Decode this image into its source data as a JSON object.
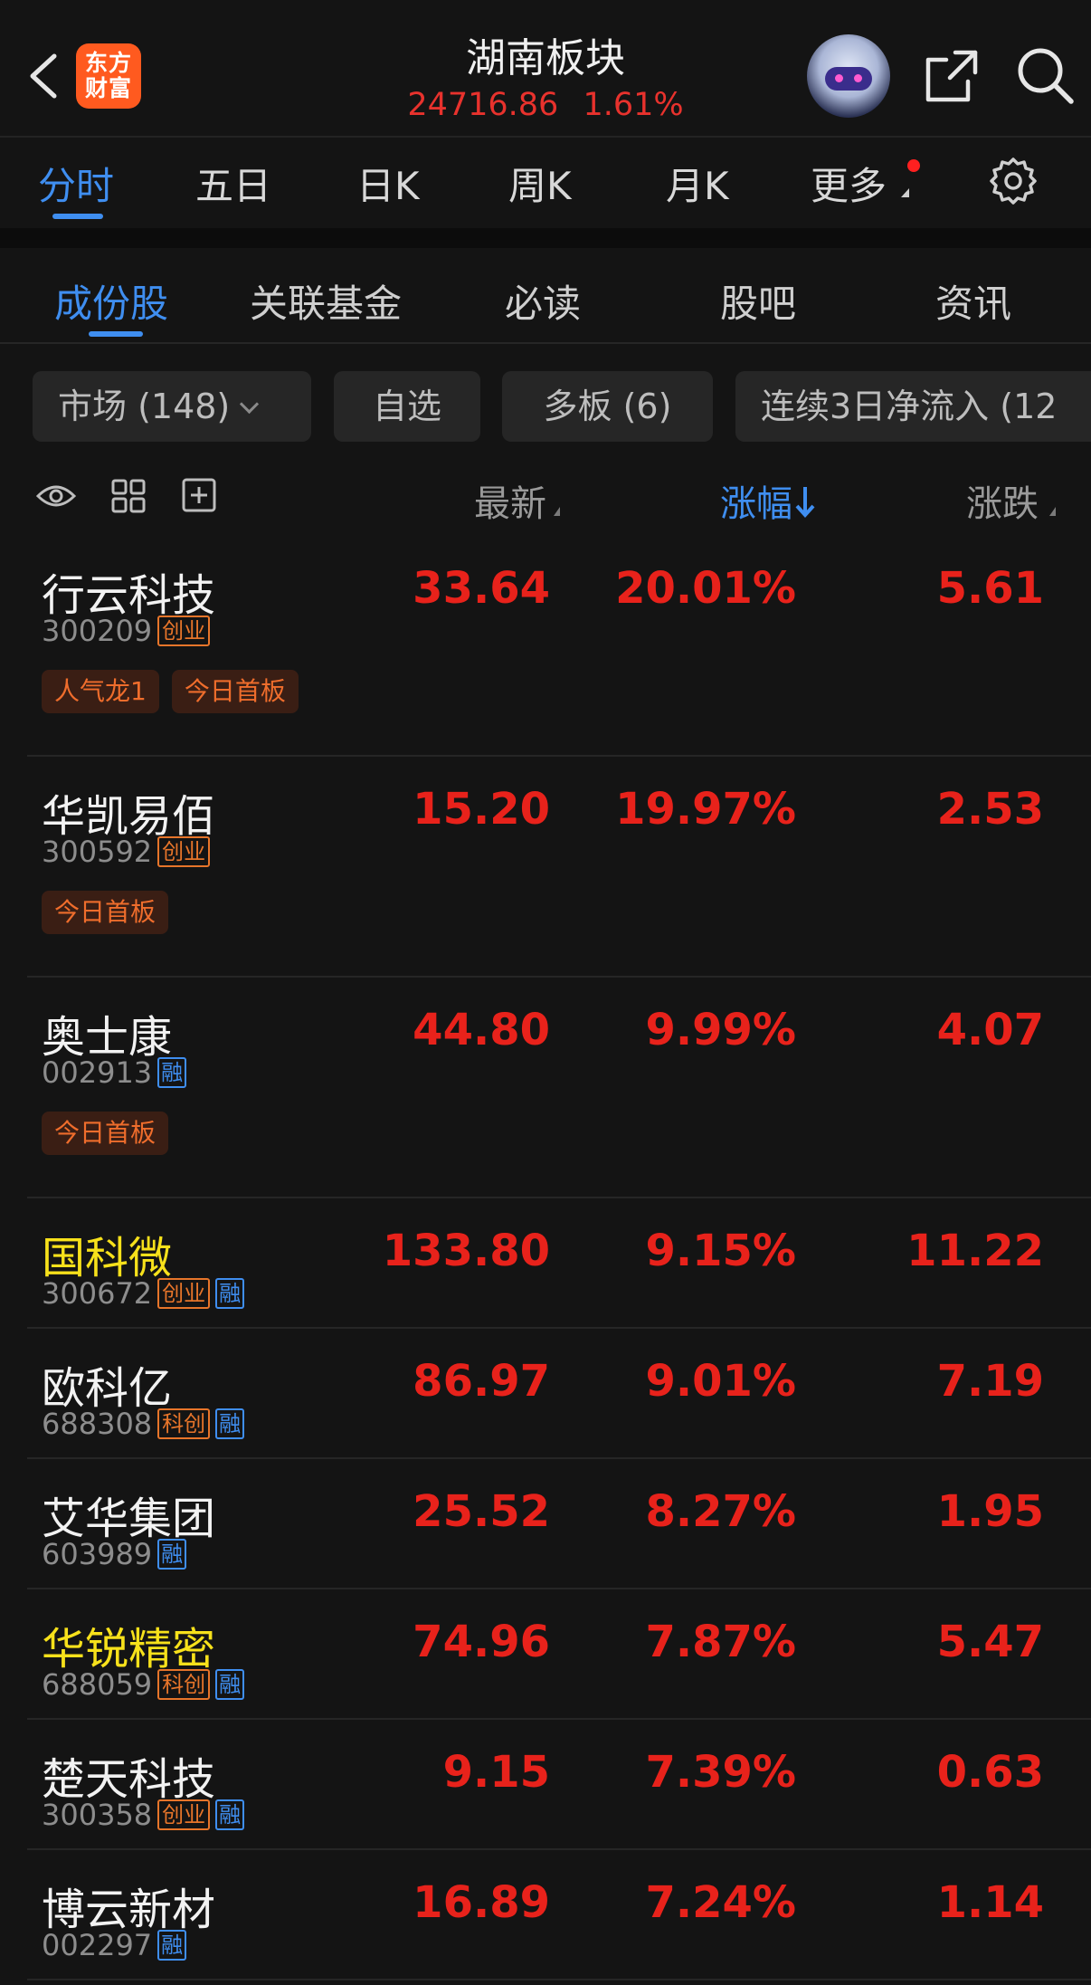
{
  "header": {
    "title": "湖南板块",
    "index_value": "24716.86",
    "index_change": "1.61%",
    "logo_line1": "东方",
    "logo_line2": "财富"
  },
  "period_tabs": [
    "分时",
    "五日",
    "日K",
    "周K",
    "月K",
    "更多"
  ],
  "content_tabs": [
    "成份股",
    "关联基金",
    "必读",
    "股吧",
    "资讯"
  ],
  "filters": [
    "市场 (148)",
    "自选",
    "多板 (6)",
    "连续3日净流入 (12"
  ],
  "columns": {
    "latest": "最新",
    "change_pct": "涨幅",
    "change": "涨跌"
  },
  "stocks": [
    {
      "name": "行云科技",
      "code": "300209",
      "badges": [
        "创业"
      ],
      "rong": false,
      "price": "33.64",
      "pct": "20.01%",
      "chg": "5.61",
      "tags": [
        "人气龙1",
        "今日首板"
      ],
      "highlight": false
    },
    {
      "name": "华凯易佰",
      "code": "300592",
      "badges": [
        "创业"
      ],
      "rong": false,
      "price": "15.20",
      "pct": "19.97%",
      "chg": "2.53",
      "tags": [
        "今日首板"
      ],
      "highlight": false
    },
    {
      "name": "奥士康",
      "code": "002913",
      "badges": [],
      "rong": true,
      "price": "44.80",
      "pct": "9.99%",
      "chg": "4.07",
      "tags": [
        "今日首板"
      ],
      "highlight": false
    },
    {
      "name": "国科微",
      "code": "300672",
      "badges": [
        "创业"
      ],
      "rong": true,
      "price": "133.80",
      "pct": "9.15%",
      "chg": "11.22",
      "tags": [],
      "highlight": true
    },
    {
      "name": "欧科亿",
      "code": "688308",
      "badges": [
        "科创"
      ],
      "rong": true,
      "price": "86.97",
      "pct": "9.01%",
      "chg": "7.19",
      "tags": [],
      "highlight": false
    },
    {
      "name": "艾华集团",
      "code": "603989",
      "badges": [],
      "rong": true,
      "price": "25.52",
      "pct": "8.27%",
      "chg": "1.95",
      "tags": [],
      "highlight": false
    },
    {
      "name": "华锐精密",
      "code": "688059",
      "badges": [
        "科创"
      ],
      "rong": true,
      "price": "74.96",
      "pct": "7.87%",
      "chg": "5.47",
      "tags": [],
      "highlight": true
    },
    {
      "name": "楚天科技",
      "code": "300358",
      "badges": [
        "创业"
      ],
      "rong": true,
      "price": "9.15",
      "pct": "7.39%",
      "chg": "0.63",
      "tags": [],
      "highlight": false
    },
    {
      "name": "博云新材",
      "code": "002297",
      "badges": [],
      "rong": true,
      "price": "16.89",
      "pct": "7.24%",
      "chg": "1.14",
      "tags": [],
      "highlight": false
    }
  ],
  "rong_label": "融",
  "colors": {
    "up": "#e8221b",
    "accent": "#3f8ef0",
    "highlight": "#f7e11b",
    "tag": "#ef6d2c"
  }
}
